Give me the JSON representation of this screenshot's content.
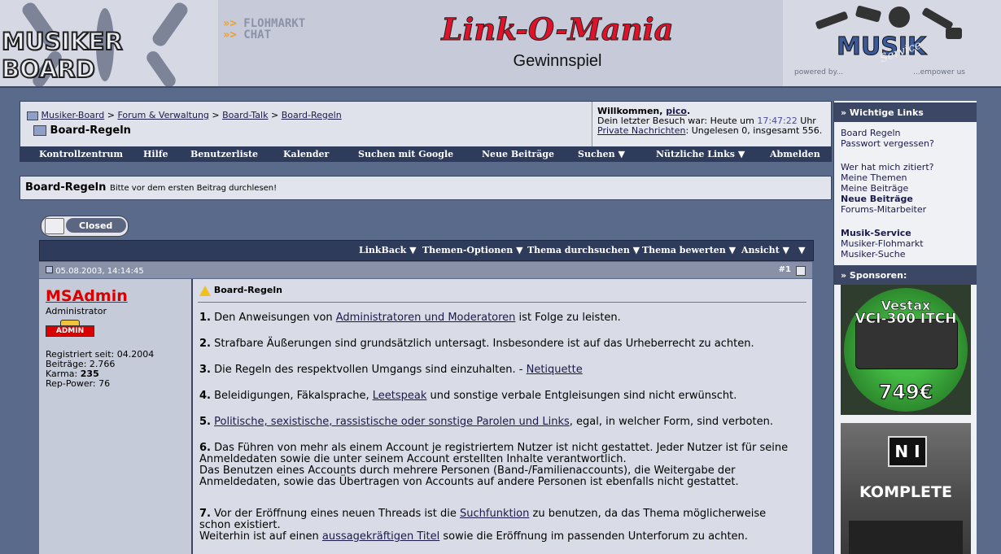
{
  "header": {
    "logo_text": "MUSIKER BOARD",
    "flohmarkt": "FLOHMARKT",
    "chat": "CHAT",
    "banner_title": "Link-O-Mania",
    "banner_sub": "Gewinnspiel",
    "musik_logo": "MUSIK",
    "musik_script": "Service",
    "powered_by": "powered by...",
    "empower_us": "...empower us"
  },
  "breadcrumb": {
    "items": [
      "Musiker-Board",
      "Forum & Verwaltung",
      "Board-Talk",
      "Board-Regeln"
    ],
    "separator": ">",
    "current": "Board-Regeln"
  },
  "welcome": {
    "label": "Willkommen,",
    "user": "pico",
    "last_visit_prefix": "Dein letzter Besuch war: Heute um",
    "last_visit_time": "17:47:22",
    "last_visit_suffix": "Uhr",
    "pm_link": "Private Nachrichten",
    "pm_status": ": Ungelesen 0, insgesamt 556."
  },
  "navbar": {
    "items": [
      "Kontrollzentrum",
      "Hilfe",
      "Benutzerliste",
      "Kalender",
      "Suchen mit Google",
      "Neue Beiträge",
      "Suchen ▼",
      "Nützliche Links ▼",
      "Abmelden"
    ]
  },
  "forum": {
    "title": "Board-Regeln",
    "subtitle": "Bitte vor dem ersten Beitrag durchlesen!"
  },
  "closed_button": "Closed",
  "thread_tools": {
    "items": [
      "LinkBack ▼",
      "Themen-Optionen ▼",
      "Thema durchsuchen ▼",
      "Thema bewerten ▼",
      "Ansicht ▼",
      "▼"
    ]
  },
  "post": {
    "date": "05.08.2003, 14:14:45",
    "number": "#1",
    "title": "Board-Regeln",
    "author": {
      "name": "MSAdmin",
      "role": "Administrator",
      "badge": "ADMIN",
      "registered": "Registriert seit: 04.2004",
      "posts": "Beiträge: 2.766",
      "karma_label": "Karma:",
      "karma": "235",
      "rep": "Rep-Power: 76"
    },
    "rules": [
      {
        "num": "1.",
        "pre": " Den Anweisungen von ",
        "link": "Administratoren und Moderatoren",
        "post": " ist Folge zu leisten."
      },
      {
        "num": "2.",
        "pre": " Strafbare Äußerungen sind grundsätzlich untersagt. Insbesondere ist auf das Urheberrecht zu achten.",
        "link": "",
        "post": ""
      },
      {
        "num": "3.",
        "pre": " Die Regeln des respektvollen Umgangs sind einzuhalten. - ",
        "link": "Netiquette",
        "post": ""
      },
      {
        "num": "4.",
        "pre": " Beleidigungen, Fäkalsprache, ",
        "link": "Leetspeak",
        "post": " und sonstige verbale Entgleisungen sind nicht erwünscht."
      },
      {
        "num": "5.",
        "pre": " ",
        "link": "Politische, sexistische, rassistische oder sonstige Parolen und Links",
        "post": ", egal, in welcher Form, sind verboten."
      }
    ],
    "rule6": {
      "num": "6.",
      "line1": " Das Führen von mehr als einem Account je registriertem Nutzer ist nicht gestattet. Jeder Nutzer ist für seine",
      "line2": "Anmeldedaten sowie die unter seinem Account erstellten Inhalte verantwortlich.",
      "line3": "Das Benutzen eines Accounts durch mehrere Personen (Band-/Familienaccounts), die Weitergabe der",
      "line4": "Anmeldedaten, sowie das Übertragen von Accounts auf andere Personen ist ebenfalls nicht gestattet."
    },
    "rule7": {
      "num": "7.",
      "pre": " Vor der Eröffnung eines neuen Threads ist die ",
      "link1": "Suchfunktion",
      "post1": " zu benutzen, da das Thema möglicherweise",
      "line2": "schon existiert.",
      "pre3": "Weiterhin ist auf einen ",
      "link3": "aussagekräftigen Titel",
      "post3": " sowie die Eröffnung im passenden Unterforum zu achten."
    }
  },
  "sidebar": {
    "head1": "» Wichtige Links",
    "group1": [
      "Board Regeln",
      "Passwort vergessen?"
    ],
    "group2": [
      "Wer hat mich zitiert?",
      "Meine Themen",
      "Meine Beiträge",
      "Neue Beiträge",
      "Forums-Mitarbeiter"
    ],
    "group3_title": "Musik-Service",
    "group3": [
      "Musiker-Flohmarkt",
      "Musiker-Suche"
    ],
    "head2": "» Sponsoren:",
    "ad1_line1": "Vestax",
    "ad1_line2": "VCI-300 ITCH",
    "ad1_price": "749€",
    "ad2_logo": "N I",
    "ad2_text": "KOMPLETE"
  }
}
